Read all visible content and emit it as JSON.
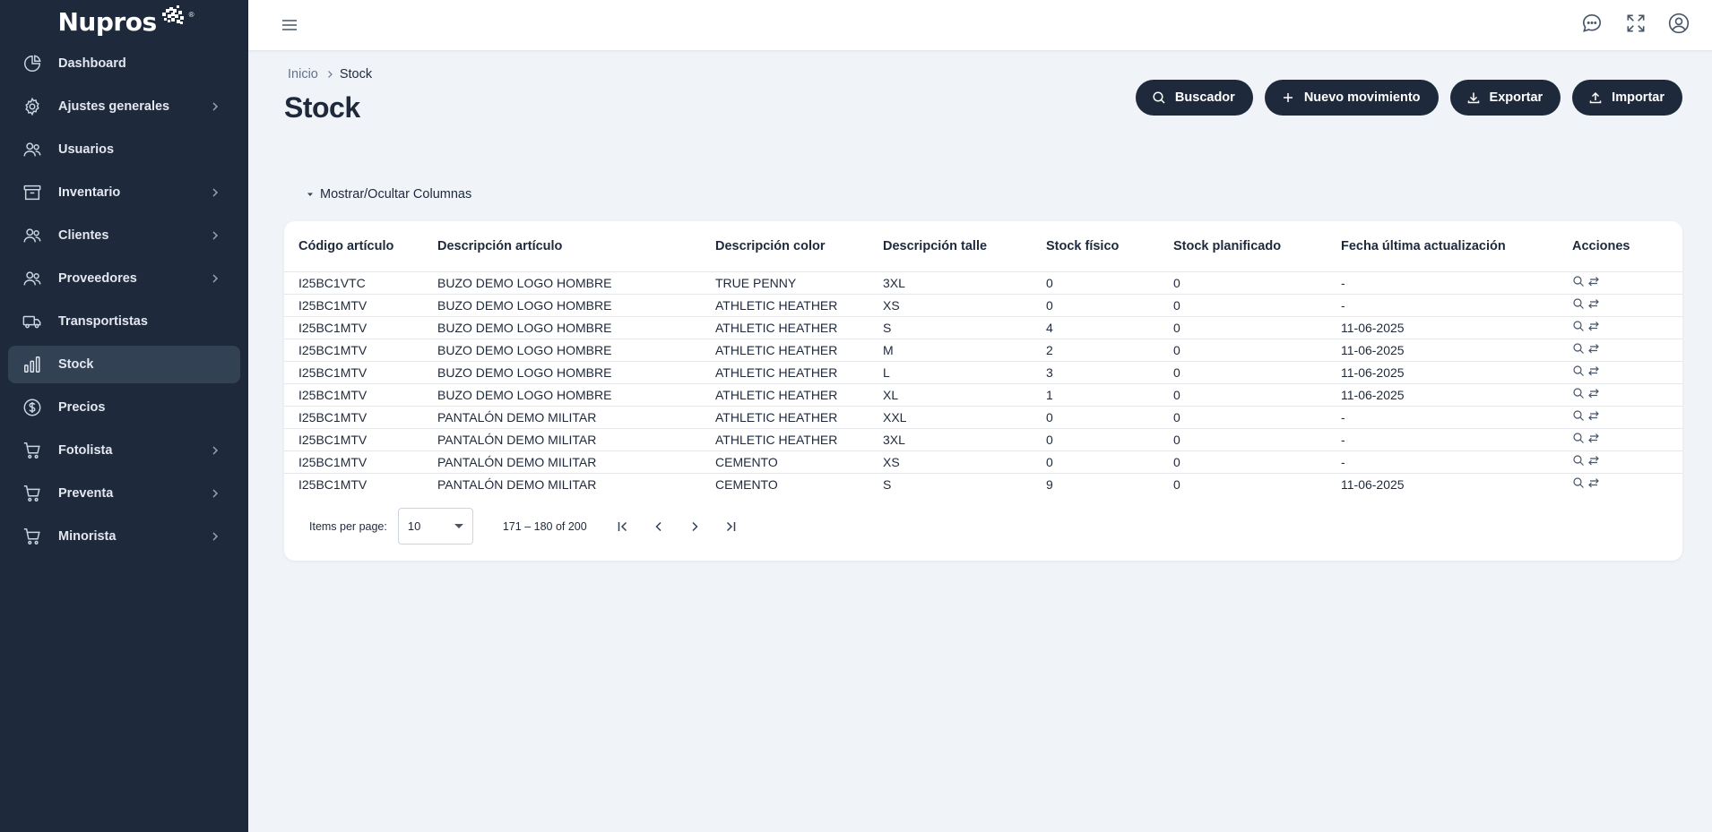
{
  "app": {
    "logo_text": "Nupros",
    "logo_mark": "®"
  },
  "colors": {
    "sidebar_bg": "#1e293b",
    "sidebar_active": "#334155",
    "content_bg": "#f0f3f8",
    "button_bg": "#1e293b"
  },
  "sidebar": {
    "items": [
      {
        "label": "Dashboard",
        "icon": "pie-chart-icon",
        "has_chevron": false
      },
      {
        "label": "Ajustes generales",
        "icon": "gear-icon",
        "has_chevron": true
      },
      {
        "label": "Usuarios",
        "icon": "users-icon",
        "has_chevron": false
      },
      {
        "label": "Inventario",
        "icon": "archive-box-icon",
        "has_chevron": true
      },
      {
        "label": "Clientes",
        "icon": "users-icon",
        "has_chevron": true
      },
      {
        "label": "Proveedores",
        "icon": "users-icon",
        "has_chevron": true
      },
      {
        "label": "Transportistas",
        "icon": "truck-icon",
        "has_chevron": false
      },
      {
        "label": "Stock",
        "icon": "bar-chart-icon",
        "has_chevron": false,
        "active": true
      },
      {
        "label": "Precios",
        "icon": "dollar-circle-icon",
        "has_chevron": false
      },
      {
        "label": "Fotolista",
        "icon": "cart-icon",
        "has_chevron": true
      },
      {
        "label": "Preventa",
        "icon": "cart-icon",
        "has_chevron": true
      },
      {
        "label": "Minorista",
        "icon": "cart-icon",
        "has_chevron": true
      }
    ]
  },
  "topbar": {
    "icons": [
      "chat-bubble-icon",
      "fullscreen-icon",
      "user-circle-icon"
    ]
  },
  "breadcrumb": {
    "home": "Inicio",
    "current": "Stock"
  },
  "page": {
    "title": "Stock"
  },
  "actions": {
    "search": "Buscador",
    "new_movement": "Nuevo movimiento",
    "export": "Exportar",
    "import": "Importar"
  },
  "columns_toggle": "Mostrar/Ocultar Columnas",
  "table": {
    "headers": [
      "Código artículo",
      "Descripción artículo",
      "Descripción color",
      "Descripción talle",
      "Stock físico",
      "Stock planificado",
      "Fecha última actualización",
      "Acciones"
    ],
    "rows": [
      [
        "I25BC1VTC",
        "BUZO DEMO LOGO HOMBRE",
        "TRUE PENNY",
        "3XL",
        "0",
        "0",
        "-"
      ],
      [
        "I25BC1MTV",
        "BUZO DEMO LOGO HOMBRE",
        "ATHLETIC HEATHER",
        "XS",
        "0",
        "0",
        "-"
      ],
      [
        "I25BC1MTV",
        "BUZO DEMO LOGO HOMBRE",
        "ATHLETIC HEATHER",
        "S",
        "4",
        "0",
        "11-06-2025"
      ],
      [
        "I25BC1MTV",
        "BUZO DEMO LOGO HOMBRE",
        "ATHLETIC HEATHER",
        "M",
        "2",
        "0",
        "11-06-2025"
      ],
      [
        "I25BC1MTV",
        "BUZO DEMO LOGO HOMBRE",
        "ATHLETIC HEATHER",
        "L",
        "3",
        "0",
        "11-06-2025"
      ],
      [
        "I25BC1MTV",
        "BUZO DEMO LOGO HOMBRE",
        "ATHLETIC HEATHER",
        "XL",
        "1",
        "0",
        "11-06-2025"
      ],
      [
        "I25BC1MTV",
        "PANTALÓN DEMO MILITAR",
        "ATHLETIC HEATHER",
        "XXL",
        "0",
        "0",
        "-"
      ],
      [
        "I25BC1MTV",
        "PANTALÓN DEMO MILITAR",
        "ATHLETIC HEATHER",
        "3XL",
        "0",
        "0",
        "-"
      ],
      [
        "I25BC1MTV",
        "PANTALÓN DEMO MILITAR",
        "CEMENTO",
        "XS",
        "0",
        "0",
        "-"
      ],
      [
        "I25BC1MTV",
        "PANTALÓN DEMO MILITAR",
        "CEMENTO",
        "S",
        "9",
        "0",
        "11-06-2025"
      ]
    ],
    "row_action_icons": [
      "magnifier-icon",
      "swap-arrows-icon"
    ]
  },
  "paginator": {
    "items_per_page_label": "Items per page:",
    "items_per_page_value": "10",
    "range_label": "171 – 180 of 200"
  }
}
